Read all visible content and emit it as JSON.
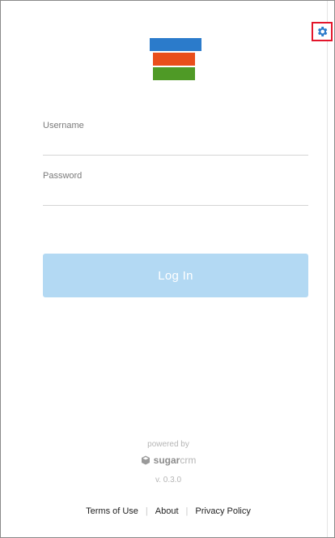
{
  "settings": {
    "icon": "gear-icon",
    "highlight_color": "#e3162b",
    "icon_color": "#2b7bcb"
  },
  "logo": {
    "colors": [
      "#2b7bcb",
      "#e94e1b",
      "#4f9a26"
    ]
  },
  "form": {
    "username_placeholder": "Username",
    "username_value": "",
    "password_placeholder": "Password",
    "password_value": "",
    "login_label": "Log In",
    "login_color": "#b3d9f3"
  },
  "branding": {
    "powered_by": "powered by",
    "brand_sugar": "sugar",
    "brand_crm": "crm",
    "version": "v. 0.3.0"
  },
  "footer": {
    "terms": "Terms of Use",
    "separator": "|",
    "about": "About",
    "privacy": "Privacy Policy"
  }
}
